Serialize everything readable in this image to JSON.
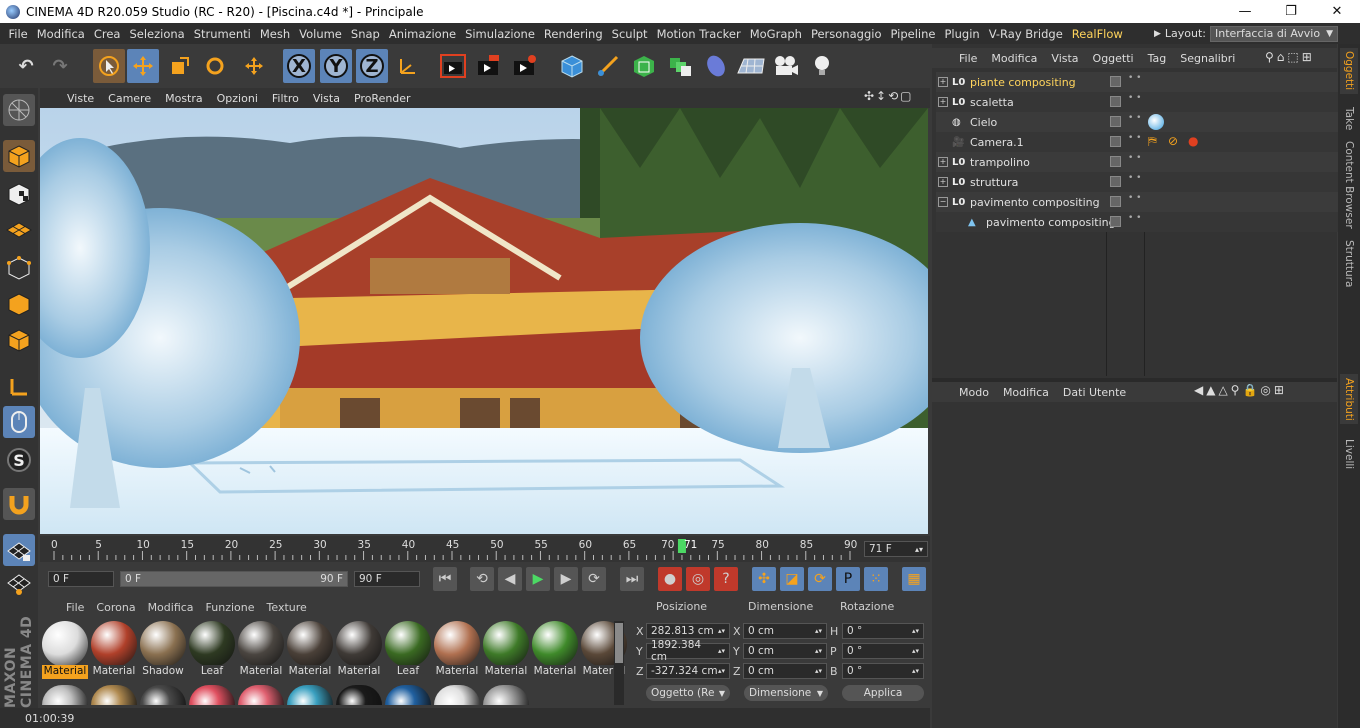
{
  "window": {
    "title": "CINEMA 4D R20.059 Studio (RC - R20) - [Piscina.c4d *] - Principale",
    "min_glyph": "—",
    "max_glyph": "❐",
    "close_glyph": "✕"
  },
  "menu": [
    "File",
    "Modifica",
    "Crea",
    "Seleziona",
    "Strumenti",
    "Mesh",
    "Volume",
    "Snap",
    "Animazione",
    "Simulazione",
    "Rendering",
    "Sculpt",
    "Motion Tracker",
    "MoGraph",
    "Personaggio",
    "Pipeline",
    "Plugin",
    "V-Ray Bridge",
    "RealFlow"
  ],
  "layout": {
    "label": "Layout:",
    "value": "Interfaccia di Avvio"
  },
  "toolbar": {
    "x_label": "X",
    "y_label": "Y",
    "z_label": "Z"
  },
  "view_menu": [
    "Viste",
    "Camere",
    "Mostra",
    "Opzioni",
    "Filtro",
    "Vista",
    "ProRender"
  ],
  "timeline": {
    "ticks": [
      "0",
      "5",
      "10",
      "15",
      "20",
      "25",
      "30",
      "35",
      "40",
      "45",
      "50",
      "55",
      "60",
      "65",
      "70",
      "71",
      "75",
      "80",
      "85",
      "90"
    ],
    "current_frame": "71 F",
    "playhead": 71,
    "max": 90
  },
  "transport": {
    "start": "0 F",
    "range_start": "0 F",
    "range_end": "90 F",
    "end": "90 F"
  },
  "materials": {
    "menu": [
      "File",
      "Corona",
      "Modifica",
      "Funzione",
      "Texture"
    ],
    "items": [
      {
        "label": "Material",
        "color": "#dcdcdc",
        "selected": true
      },
      {
        "label": "Material",
        "color": "#b0402a"
      },
      {
        "label": "Shadow",
        "color": "#8a7050"
      },
      {
        "label": "Leaf",
        "color": "#2e3a22"
      },
      {
        "label": "Material",
        "color": "#4a4540"
      },
      {
        "label": "Material",
        "color": "#4a4038"
      },
      {
        "label": "Material",
        "color": "#3f3a36"
      },
      {
        "label": "Leaf",
        "color": "#3a6a22"
      },
      {
        "label": "Material",
        "color": "#b07050"
      },
      {
        "label": "Material",
        "color": "#3e7a28"
      },
      {
        "label": "Material",
        "color": "#3f8a2a"
      },
      {
        "label": "Material",
        "color": "#5a4838"
      }
    ],
    "row2_colors": [
      "#bfbfbf",
      "#b08a50",
      "#4a4a4a",
      "#e05060",
      "#e06070",
      "#3aa0c0",
      "#1a1a1a",
      "#2060a0",
      "#e0e0e0",
      "#a0a0a0"
    ]
  },
  "coords": {
    "headers": {
      "pos": "Posizione",
      "dim": "Dimensione",
      "rot": "Rotazione"
    },
    "rows": [
      {
        "axis": "X",
        "pos": "282.813 cm",
        "daxis": "X",
        "dim": "0 cm",
        "raxis": "H",
        "rot": "0 °"
      },
      {
        "axis": "Y",
        "pos": "1892.384 cm",
        "daxis": "Y",
        "dim": "0 cm",
        "raxis": "P",
        "rot": "0 °"
      },
      {
        "axis": "Z",
        "pos": "-327.324 cm",
        "daxis": "Z",
        "dim": "0 cm",
        "raxis": "B",
        "rot": "0 °"
      }
    ],
    "mode": "Oggetto (Re",
    "dim_mode": "Dimensione",
    "apply": "Applica"
  },
  "status": {
    "time": "01:00:39"
  },
  "objects_panel": {
    "menu": [
      "File",
      "Modifica",
      "Vista",
      "Oggetti",
      "Tag",
      "Segnalibri"
    ],
    "items": [
      {
        "name": "piante compositing",
        "icon": "null-icon",
        "active": true,
        "expand": true
      },
      {
        "name": "scaletta",
        "icon": "null-icon",
        "expand": true
      },
      {
        "name": "Cielo",
        "icon": "sky-icon",
        "expand": false
      },
      {
        "name": "Camera.1",
        "icon": "camera-icon",
        "expand": false
      },
      {
        "name": "trampolino",
        "icon": "null-icon",
        "expand": true
      },
      {
        "name": "struttura",
        "icon": "null-icon",
        "expand": true
      },
      {
        "name": "pavimento compositing",
        "icon": "null-icon",
        "expand": true,
        "open": true
      },
      {
        "name": "pavimento compositing",
        "icon": "polygon-icon",
        "expand": false,
        "child": true
      }
    ]
  },
  "attributes_panel": {
    "menu": [
      "Modo",
      "Modifica",
      "Dati Utente"
    ]
  },
  "side_tabs": [
    "Oggetti",
    "Take",
    "Content Browser",
    "Struttura",
    "Attributi",
    "Livelli"
  ],
  "colors": {
    "accent_orange": "#f4a21e",
    "selection_blue": "#5c84b8",
    "highlight_text": "#ffd45c"
  }
}
